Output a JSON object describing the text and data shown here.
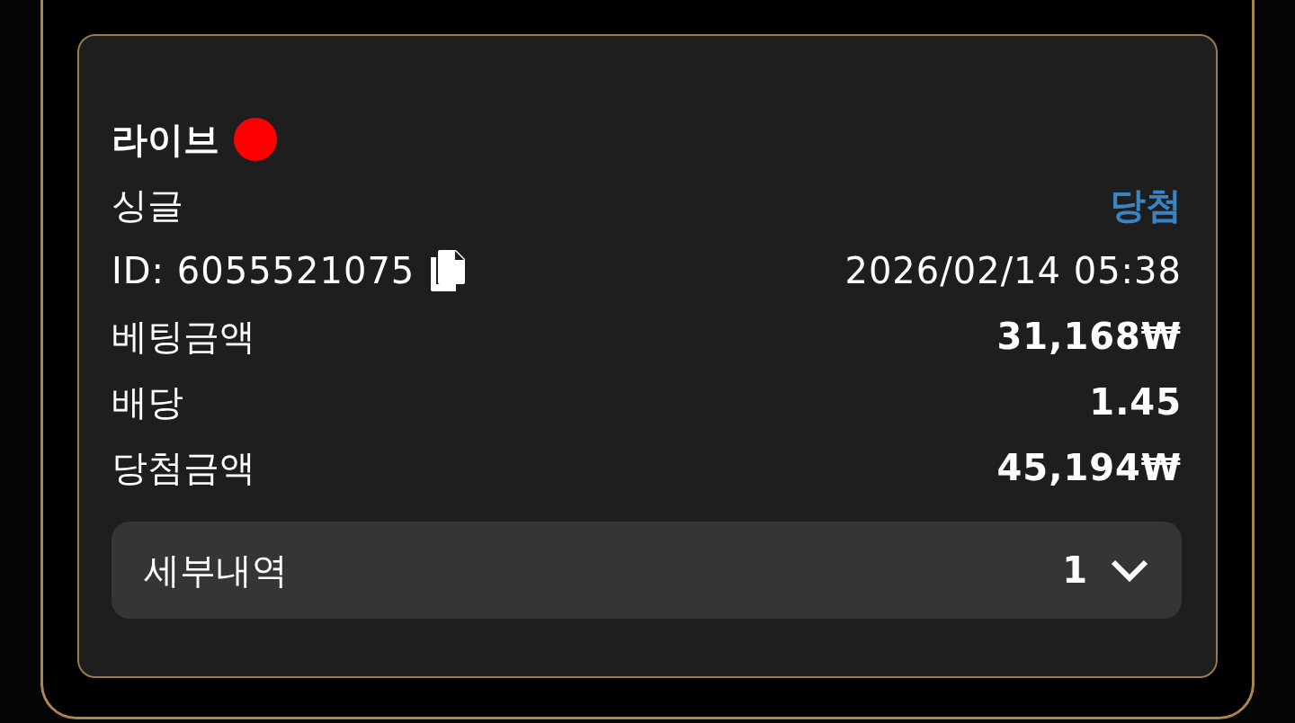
{
  "bet": {
    "type": "라이브",
    "live": true,
    "market": "싱글",
    "result": "당첨",
    "id": "ID: 6055521075",
    "datetime": "2026/02/14 05:38"
  },
  "rows": [
    {
      "label": "베팅금액",
      "value": "31,168₩"
    },
    {
      "label": "배당",
      "value": "1.45"
    },
    {
      "label": "당첨금액",
      "value": "45,194₩"
    }
  ],
  "details": {
    "label": "세부내역",
    "count": "1",
    "expanded": false
  }
}
